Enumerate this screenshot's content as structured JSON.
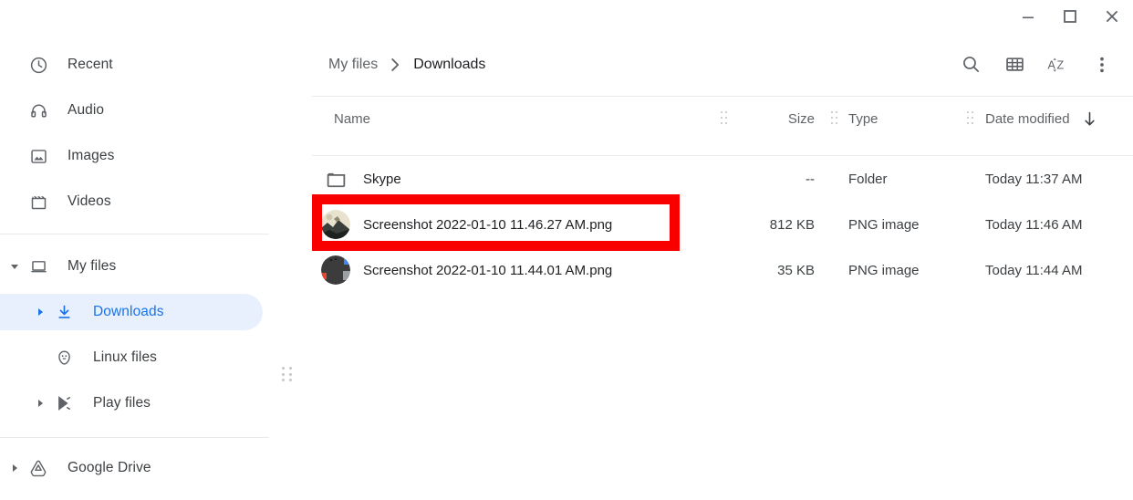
{
  "window": {
    "minimize_label": "Minimize",
    "maximize_label": "Maximize",
    "close_label": "Close"
  },
  "sidebar": {
    "shortcuts": [
      {
        "label": "Recent",
        "icon": "clock-icon"
      },
      {
        "label": "Audio",
        "icon": "headphones-icon"
      },
      {
        "label": "Images",
        "icon": "image-icon"
      },
      {
        "label": "Videos",
        "icon": "video-icon"
      }
    ],
    "my_files": {
      "label": "My files",
      "icon": "computer-icon",
      "expanded": true,
      "children": [
        {
          "label": "Downloads",
          "icon": "download-icon",
          "selected": true,
          "expandable": true
        },
        {
          "label": "Linux files",
          "icon": "linux-penguin-icon",
          "selected": false,
          "expandable": false
        },
        {
          "label": "Play files",
          "icon": "play-store-icon",
          "selected": false,
          "expandable": true
        }
      ]
    },
    "google_drive": {
      "label": "Google Drive",
      "icon": "google-drive-icon",
      "expandable": true
    }
  },
  "breadcrumb": {
    "root": "My files",
    "separator": "›",
    "current": "Downloads"
  },
  "toolbar": {
    "search_label": "Search",
    "view_label": "Switch to grid view",
    "sort_label": "Sort",
    "menu_label": "More actions"
  },
  "columns": {
    "name": "Name",
    "size": "Size",
    "type": "Type",
    "date": "Date modified",
    "sort_direction": "descending"
  },
  "files": [
    {
      "name": "Skype",
      "size": "--",
      "type": "Folder",
      "date": "Today 11:37 AM",
      "icon": "folder-icon",
      "highlighted": false
    },
    {
      "name": "Screenshot 2022-01-10 11.46.27 AM.png",
      "size": "812 KB",
      "type": "PNG image",
      "date": "Today 11:46 AM",
      "icon": "image-thumbnail-light",
      "highlighted": true
    },
    {
      "name": "Screenshot 2022-01-10 11.44.01 AM.png",
      "size": "35 KB",
      "type": "PNG image",
      "date": "Today 11:44 AM",
      "icon": "image-thumbnail-dark",
      "highlighted": false
    }
  ],
  "colors": {
    "accent": "#1a73e8",
    "selected_bg": "#e8f0fe",
    "highlight_box": "#f80000",
    "text_primary": "#202124",
    "text_secondary": "#5f6368",
    "divider": "#e8eaed"
  }
}
